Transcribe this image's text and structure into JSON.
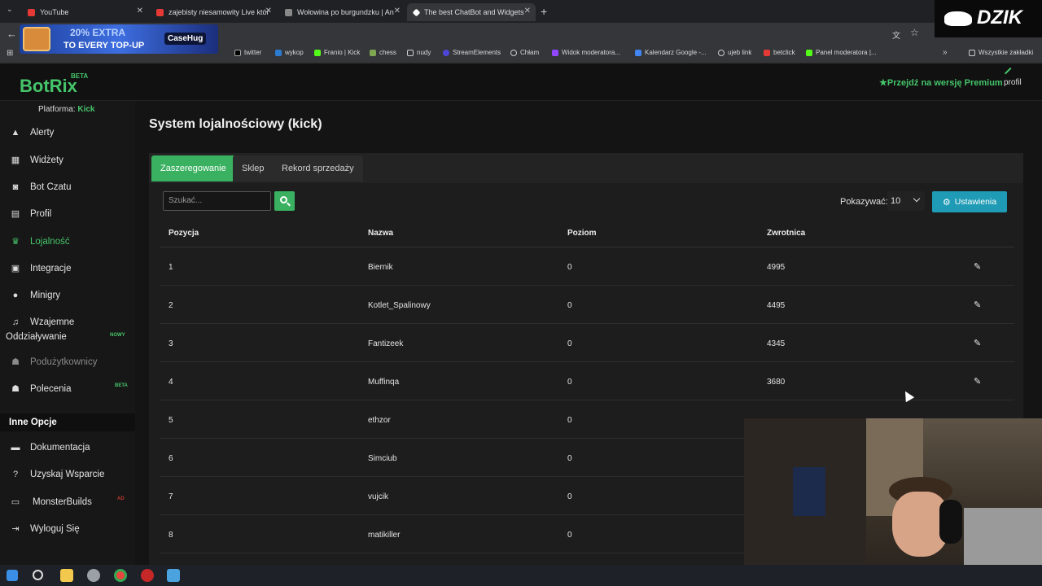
{
  "browser": {
    "tabs": [
      {
        "label": "YouTube",
        "color": "#e53935"
      },
      {
        "label": "zajebisty niesamowity Live któr",
        "color": "#e53935"
      },
      {
        "label": "Wołowina po burgundzku | An",
        "color": "#888888"
      },
      {
        "label": "The best ChatBot and Widgets",
        "color": "#ffffff"
      }
    ],
    "bookmarks": [
      "twitter",
      "wykop",
      "Franio | Kick",
      "chess",
      "nudy",
      "StreamElements",
      "Chłam",
      "Widok moderatora...",
      "Kalendarz Google -...",
      "ujeb link",
      "betclick",
      "Panel moderatora |..."
    ],
    "all_bookmarks": "Wszystkie zakładki",
    "ad": {
      "line1": "20% EXTRA",
      "line2": "TO EVERY TOP-UP",
      "brand": "CaseHug"
    },
    "overlay_logo": "DZIK"
  },
  "app": {
    "logo": "BotRix",
    "logo_badge": "BETA",
    "premium": "Przejdź na wersję Premium",
    "profile": "profil",
    "accent": "#45c56a"
  },
  "sidebar": {
    "platform_label": "Platforma:",
    "platform_value": "Kick",
    "items": [
      {
        "label": "Alerty",
        "icon": "warning-icon"
      },
      {
        "label": "Widżety",
        "icon": "grid-icon"
      },
      {
        "label": "Bot Czatu",
        "icon": "robot-icon"
      },
      {
        "label": "Profil",
        "icon": "id-card-icon"
      },
      {
        "label": "Lojalność",
        "icon": "trophy-icon"
      },
      {
        "label": "Integracje",
        "icon": "plug-icon"
      },
      {
        "label": "Minigry",
        "icon": "gamepad-icon"
      },
      {
        "label": "Wzajemne",
        "label2": "Oddziaływanie",
        "icon": "music-icon",
        "badge": "NOWY"
      },
      {
        "label": "Podużytkownicy",
        "icon": "users-icon"
      },
      {
        "label": "Polecenia",
        "icon": "people-icon",
        "badge": "BETA"
      }
    ],
    "section_title": "Inne Opcje",
    "other": [
      {
        "label": "Dokumentacja",
        "icon": "book-icon"
      },
      {
        "label": "Uzyskaj Wsparcie",
        "icon": "help-icon"
      },
      {
        "label": "MonsterBuilds",
        "icon": "laptop-icon",
        "badge": "AD"
      },
      {
        "label": "Wyloguj Się",
        "icon": "logout-icon"
      }
    ]
  },
  "main": {
    "title": "System lojalnościowy (kick)",
    "tabs": [
      "Zaszeregowanie",
      "Sklep",
      "Rekord sprzedaży"
    ],
    "search_placeholder": "Szukać...",
    "show_label": "Pokazywać:",
    "show_value": "10",
    "settings_label": "Ustawienia",
    "columns": [
      "Pozycja",
      "Nazwa",
      "Poziom",
      "Zwrotnica"
    ],
    "rows": [
      {
        "pos": "1",
        "name": "Biernik",
        "level": "0",
        "points": "4995"
      },
      {
        "pos": "2",
        "name": "Kotlet_Spalinowy",
        "level": "0",
        "points": "4495"
      },
      {
        "pos": "3",
        "name": "Fantizeek",
        "level": "0",
        "points": "4345"
      },
      {
        "pos": "4",
        "name": "Muffinqa",
        "level": "0",
        "points": "3680"
      },
      {
        "pos": "5",
        "name": "ethzor",
        "level": "0",
        "points": ""
      },
      {
        "pos": "6",
        "name": "Simciub",
        "level": "0",
        "points": ""
      },
      {
        "pos": "7",
        "name": "vujcik",
        "level": "0",
        "points": ""
      },
      {
        "pos": "8",
        "name": "matikiller",
        "level": "0",
        "points": ""
      }
    ]
  }
}
